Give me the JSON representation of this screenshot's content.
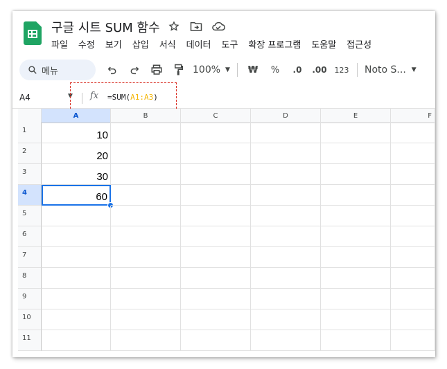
{
  "header": {
    "title": "구글 시트 SUM 함수"
  },
  "menu": [
    "파일",
    "수정",
    "보기",
    "삽입",
    "서식",
    "데이터",
    "도구",
    "확장 프로그램",
    "도움말",
    "접근성"
  ],
  "toolbar": {
    "search_label": "메뉴",
    "zoom": "100%",
    "currency": "₩",
    "percent": "%",
    "decrease_decimal": ".0",
    "increase_decimal": ".00",
    "number_format": "123",
    "font": "Noto S..."
  },
  "formula_bar": {
    "cell_ref": "A4",
    "fx": "fx",
    "formula_prefix": "=SUM(",
    "formula_range": "A1:A3",
    "formula_suffix": ")"
  },
  "grid": {
    "columns": [
      "A",
      "B",
      "C",
      "D",
      "E",
      "F"
    ],
    "rows": [
      "1",
      "2",
      "3",
      "4",
      "5",
      "6",
      "7",
      "8",
      "9",
      "10",
      "11"
    ],
    "cells": {
      "A1": "10",
      "A2": "20",
      "A3": "30",
      "A4": "60"
    },
    "selected_cell": "A4"
  }
}
